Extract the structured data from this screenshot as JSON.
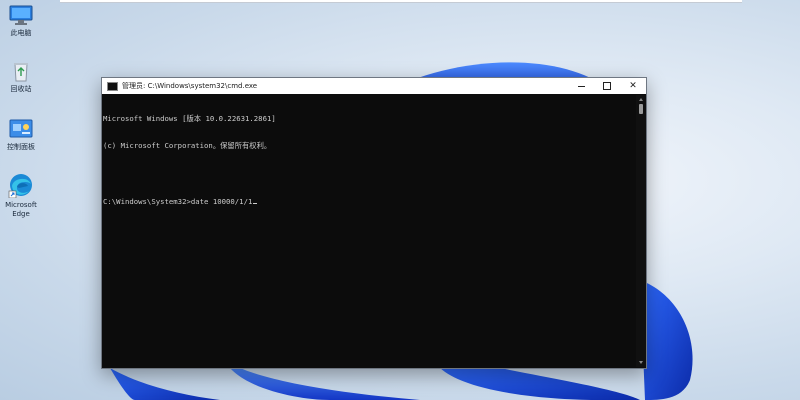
{
  "desktop": {
    "icons": [
      {
        "label": "此电脑",
        "icon": "computer-icon"
      },
      {
        "label": "回收站",
        "icon": "recycle-bin-icon"
      },
      {
        "label": "控制面板",
        "icon": "control-panel-icon"
      },
      {
        "label": "Microsoft Edge",
        "icon": "edge-icon"
      }
    ]
  },
  "cmd_window": {
    "title": "管理员: C:\\Windows\\system32\\cmd.exe",
    "controls": {
      "minimize": "–",
      "maximize": "□",
      "close": "✕"
    },
    "lines": [
      "Microsoft Windows [版本 10.0.22631.2861]",
      "(c) Microsoft Corporation。保留所有权利。",
      "",
      "C:\\Windows\\System32>date 10000/1/1"
    ]
  },
  "colors": {
    "console_bg": "#0c0c0c",
    "console_text": "#cccccc",
    "titlebar_bg": "#ffffff",
    "bloom_blue": "#1f47d6"
  }
}
